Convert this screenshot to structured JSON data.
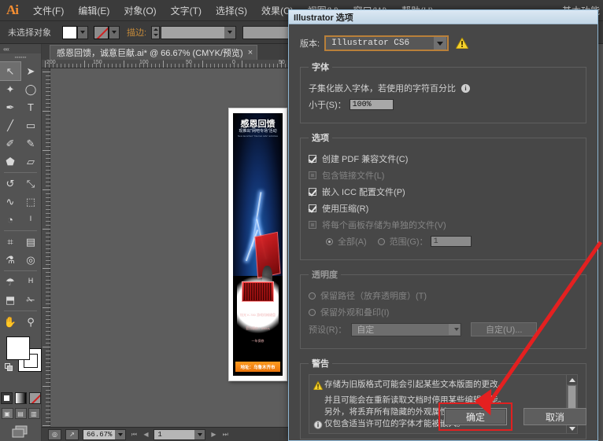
{
  "app": {
    "logo": "Ai",
    "menus": [
      {
        "label": "文件(F)"
      },
      {
        "label": "编辑(E)"
      },
      {
        "label": "对象(O)"
      },
      {
        "label": "文字(T)"
      },
      {
        "label": "选择(S)"
      },
      {
        "label": "效果(C)"
      },
      {
        "label": "视图(V)"
      },
      {
        "label": "窗口(W)"
      },
      {
        "label": "帮助(H)"
      }
    ],
    "workspace_label": "基本功能"
  },
  "control_bar": {
    "selection_label": "未选择对象",
    "fill_label": "填色",
    "stroke_label": "描边:",
    "stroke_weight": "",
    "brush_value": ""
  },
  "toolbox": {
    "tools": [
      {
        "name": "selection-tool",
        "glyph": "↖",
        "selected": true
      },
      {
        "name": "direct-selection-tool",
        "glyph": "➤",
        "selected": false
      },
      {
        "name": "magic-wand-tool",
        "glyph": "✦",
        "selected": false
      },
      {
        "name": "lasso-tool",
        "glyph": "◯",
        "selected": false
      },
      {
        "name": "pen-tool",
        "glyph": "✒",
        "selected": false
      },
      {
        "name": "type-tool",
        "glyph": "T",
        "selected": false
      },
      {
        "name": "line-segment-tool",
        "glyph": "╱",
        "selected": false
      },
      {
        "name": "rectangle-tool",
        "glyph": "▭",
        "selected": false
      },
      {
        "name": "paintbrush-tool",
        "glyph": "✐",
        "selected": false
      },
      {
        "name": "pencil-tool",
        "glyph": "✎",
        "selected": false
      },
      {
        "name": "blob-brush-tool",
        "glyph": "⬟",
        "selected": false
      },
      {
        "name": "eraser-tool",
        "glyph": "▱",
        "selected": false
      },
      {
        "name": "rotate-tool",
        "glyph": "↺",
        "selected": false
      },
      {
        "name": "scale-tool",
        "glyph": "⤡",
        "selected": false
      },
      {
        "name": "width-tool",
        "glyph": "∿",
        "selected": false
      },
      {
        "name": "free-transform-tool",
        "glyph": "⬚",
        "selected": false
      },
      {
        "name": "shape-builder-tool",
        "glyph": "◔",
        "selected": false
      },
      {
        "name": "column-graph-tool",
        "glyph": "ᴵ",
        "selected": false
      },
      {
        "name": "mesh-tool",
        "glyph": "⌗",
        "selected": false
      },
      {
        "name": "gradient-tool",
        "glyph": "▤",
        "selected": false
      },
      {
        "name": "eyedropper-tool",
        "glyph": "⚗",
        "selected": false
      },
      {
        "name": "blend-tool",
        "glyph": "◎",
        "selected": false
      },
      {
        "name": "symbol-sprayer-tool",
        "glyph": "☂",
        "selected": false
      },
      {
        "name": "graph-tool",
        "glyph": "ᴴ",
        "selected": false
      },
      {
        "name": "artboard-tool",
        "glyph": "⬒",
        "selected": false
      },
      {
        "name": "slice-tool",
        "glyph": "✁",
        "selected": false
      },
      {
        "name": "hand-tool",
        "glyph": "✋",
        "selected": false
      },
      {
        "name": "zoom-tool",
        "glyph": "⚲",
        "selected": false
      }
    ]
  },
  "document": {
    "tab_title": "感恩回馈，诚意巨献.ai* @ 66.67% (CMYK/预览)",
    "tab_close": "×",
    "ruler_labels": [
      "200",
      "150",
      "100",
      "50",
      "0",
      "50"
    ]
  },
  "artwork": {
    "headline": "感恩回馈",
    "subhead": "现推出“网吧专场”活动",
    "eng_line1": "New launched \"Internet cafe\" activities",
    "product_line1": "炫光 K-780 游戏机械键盘",
    "product_line2": "官方原价：240元",
    "product_line3": "一年保修",
    "address_bar": "地址：乌鲁木齐市"
  },
  "statusbar": {
    "zoom_value": "66.67%",
    "page_value": "1"
  },
  "dialog": {
    "title": "Illustrator 选项",
    "version_label": "版本:",
    "version_value": "Illustrator CS6",
    "fonts": {
      "legend": "字体",
      "desc": "子集化嵌入字体，若使用的字符百分比",
      "threshold_label": "小于(S)：",
      "threshold_value": "100%"
    },
    "options": {
      "legend": "选项",
      "items": [
        {
          "label": "创建 PDF 兼容文件(C)",
          "checked": true,
          "disabled": false
        },
        {
          "label": "包含链接文件(L)",
          "checked": false,
          "disabled": true
        },
        {
          "label": "嵌入 ICC 配置文件(P)",
          "checked": true,
          "disabled": false
        },
        {
          "label": "使用压缩(R)",
          "checked": true,
          "disabled": false
        },
        {
          "label": "将每个画板存储为单独的文件(V)",
          "checked": false,
          "disabled": true
        }
      ],
      "radio_all": "全部(A)",
      "radio_range": "范围(G)：",
      "range_value": "1"
    },
    "transparency": {
      "legend": "透明度",
      "radio_preserve_paths": "保留路径（放弃透明度）(T)",
      "radio_preserve_appearance": "保留外观和叠印(I)",
      "preset_label": "预设(R)：",
      "preset_value": "自定",
      "custom_button": "自定(U)..."
    },
    "warnings": {
      "legend": "警告",
      "items": [
        {
          "icon": "warning-icon",
          "lines": [
            "存储为旧版格式可能会引起某些文本版面的更改。",
            "并且可能会在重新读取文档时停用某些编辑功能。",
            "另外，将丢弃所有隐藏的外观属性。"
          ]
        },
        {
          "icon": "info-icon",
          "lines": [
            "仅包含适当许可位的字体才能被嵌入。"
          ]
        }
      ]
    },
    "ok_button": "确定",
    "cancel_button": "取消"
  },
  "annotation": {
    "arrow_color": "#e42020",
    "highlight_color": "#e02020"
  }
}
